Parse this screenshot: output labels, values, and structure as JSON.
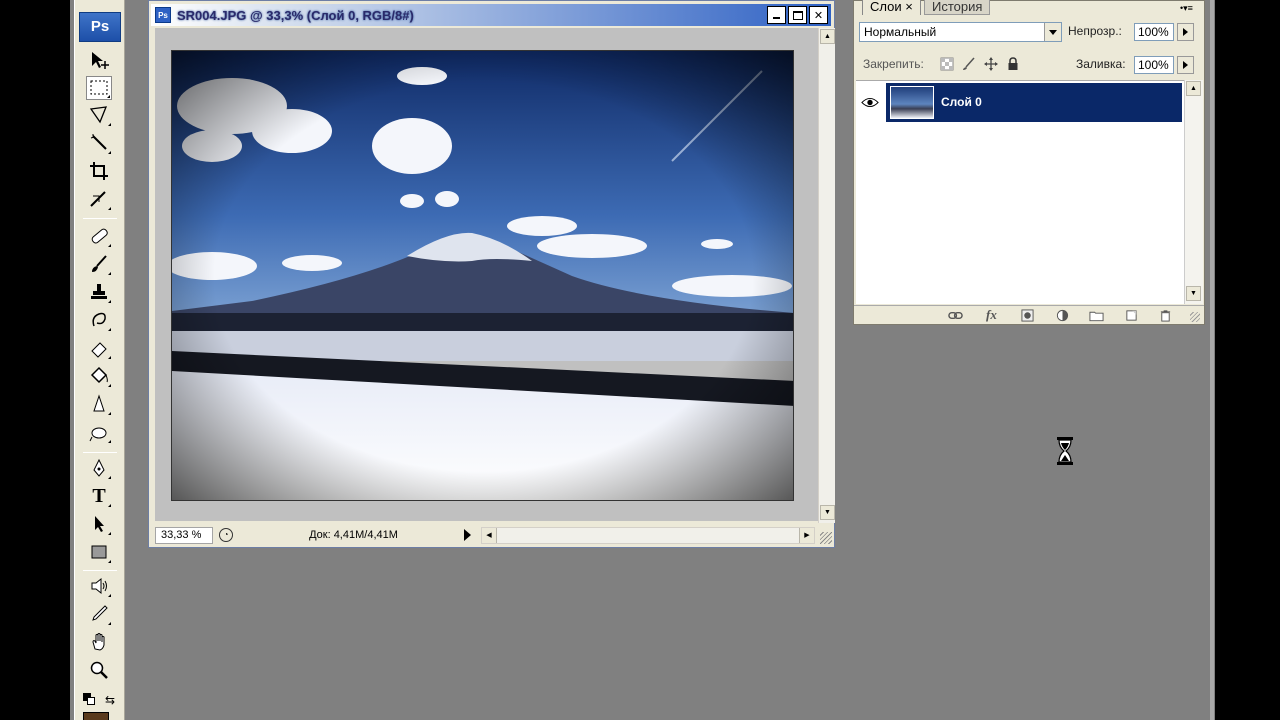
{
  "document": {
    "title": "SR004.JPG @ 33,3% (Слой 0, RGB/8#)",
    "app_icon_text": "Ps",
    "zoom": "33,33 %",
    "doc_info": "Док: 4,41M/4,41M"
  },
  "toolbox": {
    "logo": "Ps",
    "tools": [
      "move-tool",
      "marquee-tool",
      "lasso-tool",
      "magic-wand-tool",
      "crop-tool",
      "slice-tool",
      "healing-brush-tool",
      "brush-tool",
      "clone-stamp-tool",
      "history-brush-tool",
      "eraser-tool",
      "paint-bucket-tool",
      "blur-tool",
      "dodge-tool",
      "pen-tool",
      "type-tool",
      "path-selection-tool",
      "rectangle-tool",
      "notes-tool",
      "eyedropper-tool",
      "hand-tool",
      "zoom-tool"
    ],
    "type_label": "T"
  },
  "layers_panel": {
    "tab_layers": "Слои ×",
    "tab_history": "История",
    "blend_mode": "Нормальный",
    "opacity_label": "Непрозр.:",
    "opacity_value": "100%",
    "lock_label": "Закрепить:",
    "fill_label": "Заливка:",
    "fill_value": "100%",
    "layer_name": "Слой 0"
  },
  "colors": {
    "workspace": "#808080",
    "selection": "#0a2868",
    "panel": "#ece9d8"
  }
}
